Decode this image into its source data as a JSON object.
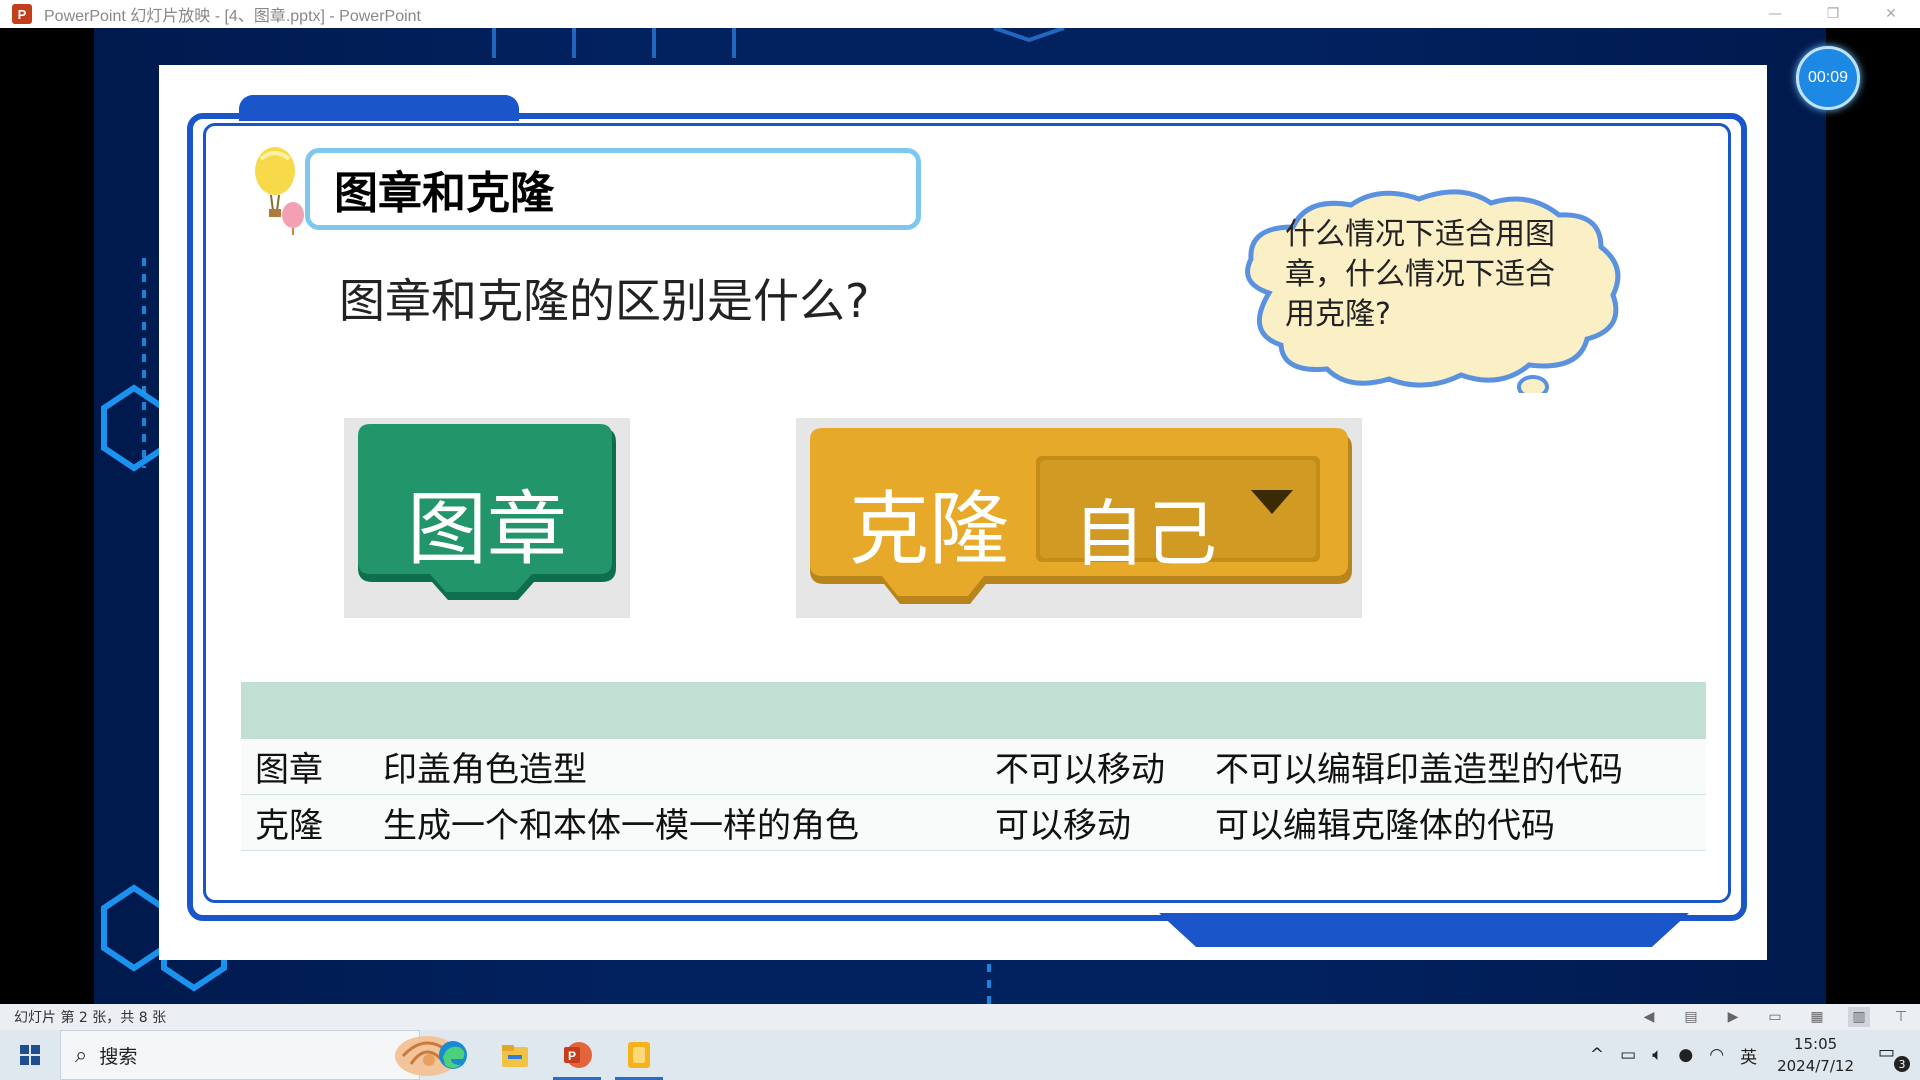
{
  "window": {
    "app_icon_letter": "P",
    "title": "PowerPoint 幻灯片放映 - [4、图章.pptx] - PowerPoint",
    "minimize": "—",
    "restore": "❐",
    "close": "✕"
  },
  "timer": "00:09",
  "slide": {
    "heading": "图章和克隆",
    "question": "图章和克隆的区别是什么?",
    "cloud_text": "什么情况下适合用图章，什么情况下适合用克隆?",
    "stamp_block_label": "图章",
    "clone_block_label": "克隆",
    "clone_dropdown_value": "自己",
    "table": {
      "rows": [
        [
          "图章",
          "印盖角色造型",
          "不可以移动",
          "不可以编辑印盖造型的代码"
        ],
        [
          "克隆",
          "生成一个和本体一模一样的角色",
          "可以移动",
          "可以编辑克隆体的代码"
        ]
      ]
    }
  },
  "statusbar": {
    "slide_count": "幻灯片 第 2 张，共 8 张"
  },
  "taskbar": {
    "search_placeholder": "搜索",
    "tray_lang": "英",
    "time": "15:05",
    "date": "2024/7/12",
    "notification_count": "3"
  },
  "colors": {
    "frame_blue": "#1a56c9",
    "stamp_green": "#22966a",
    "clone_orange": "#e6a92a",
    "table_header": "#c1e0d3"
  }
}
